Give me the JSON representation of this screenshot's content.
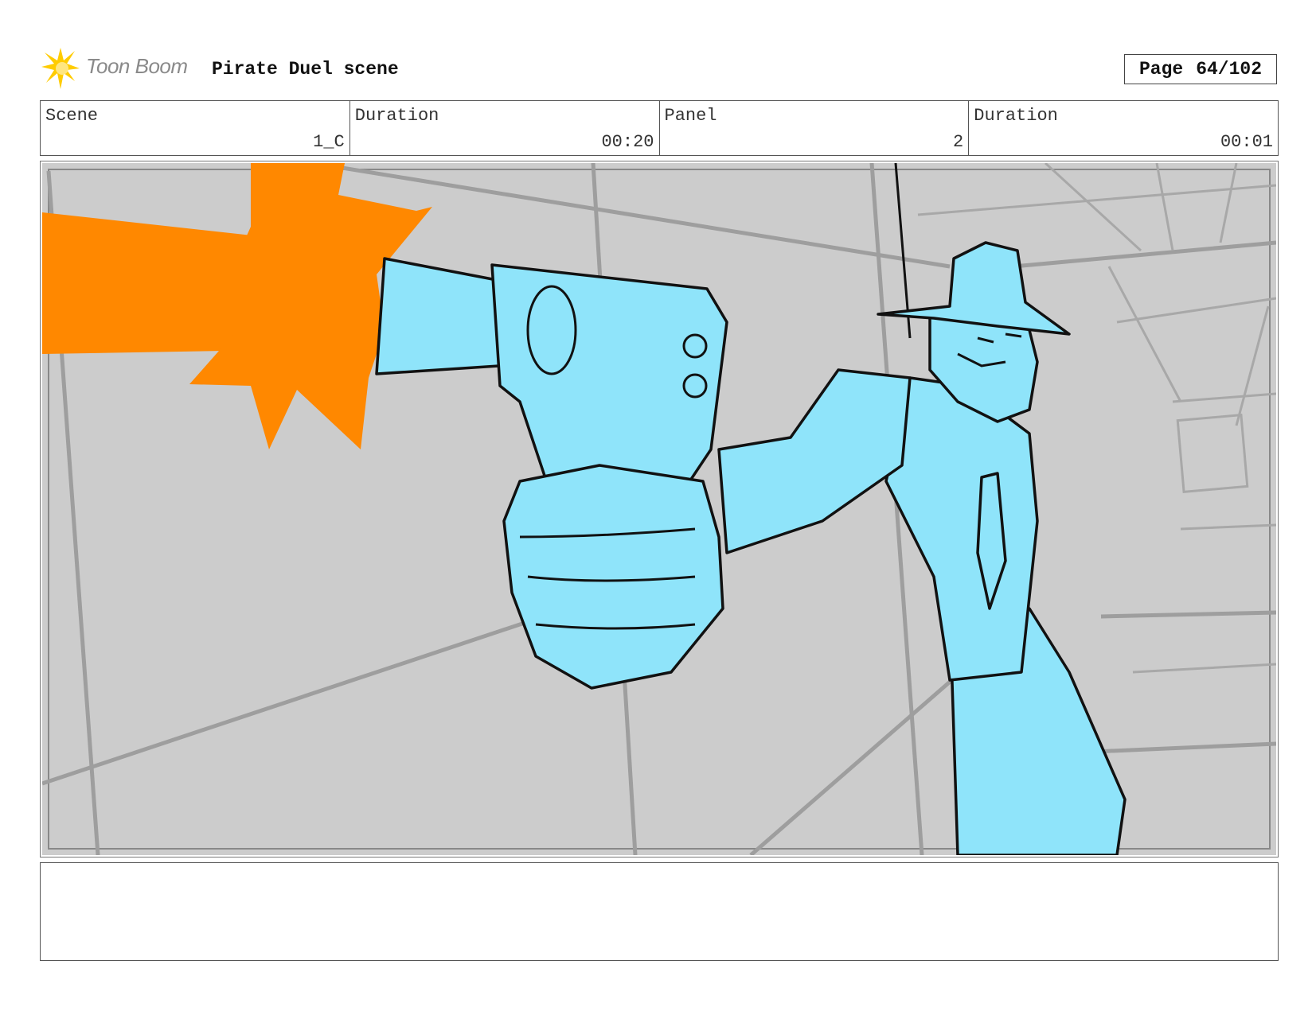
{
  "header": {
    "logo_text": "Toon Boom",
    "title": "Pirate Duel scene",
    "page_label": "Page",
    "page_value": "64/102"
  },
  "info": {
    "scene_label": "Scene",
    "scene_value": "1_C",
    "scene_duration_label": "Duration",
    "scene_duration_value": "00:20",
    "panel_label": "Panel",
    "panel_value": "2",
    "panel_duration_label": "Duration",
    "panel_duration_value": "00:01"
  },
  "colors": {
    "background_fill": "#cccccc",
    "character_fill": "#8fe4fa",
    "muzzle_flash": "#ff8800",
    "line_art": "#111111"
  },
  "notes": {
    "text": ""
  }
}
